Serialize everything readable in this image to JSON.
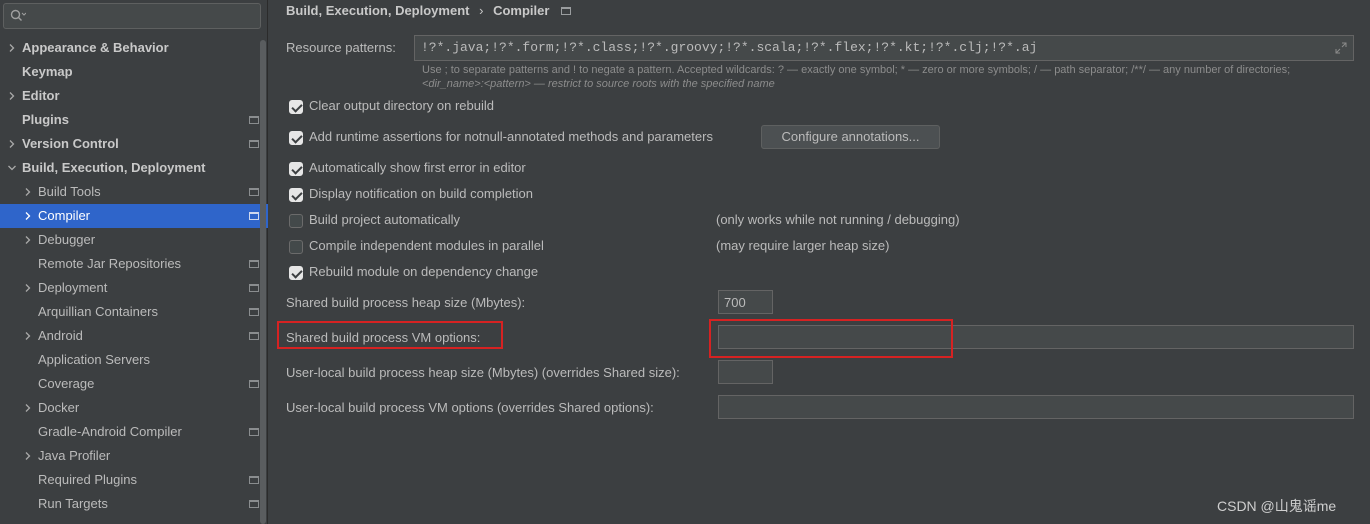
{
  "sidebar": {
    "search": {
      "placeholder": ""
    },
    "items": [
      {
        "label": "Appearance & Behavior",
        "expanded": false,
        "has_chevron": true,
        "level": 0,
        "bold": true,
        "project_icon": false
      },
      {
        "label": "Keymap",
        "has_chevron": false,
        "level": 0,
        "bold": true,
        "project_icon": false
      },
      {
        "label": "Editor",
        "expanded": false,
        "has_chevron": true,
        "level": 0,
        "bold": true,
        "project_icon": false
      },
      {
        "label": "Plugins",
        "has_chevron": false,
        "level": 0,
        "bold": true,
        "project_icon": true
      },
      {
        "label": "Version Control",
        "expanded": false,
        "has_chevron": true,
        "level": 0,
        "bold": true,
        "project_icon": true
      },
      {
        "label": "Build, Execution, Deployment",
        "expanded": true,
        "has_chevron": true,
        "level": 0,
        "bold": true,
        "project_icon": false
      },
      {
        "label": "Build Tools",
        "expanded": false,
        "has_chevron": true,
        "level": 1,
        "bold": false,
        "project_icon": true
      },
      {
        "label": "Compiler",
        "expanded": false,
        "has_chevron": true,
        "level": 1,
        "bold": false,
        "project_icon": true,
        "selected": true
      },
      {
        "label": "Debugger",
        "expanded": false,
        "has_chevron": true,
        "level": 1,
        "bold": false,
        "project_icon": false
      },
      {
        "label": "Remote Jar Repositories",
        "has_chevron": false,
        "level": 1,
        "bold": false,
        "project_icon": true
      },
      {
        "label": "Deployment",
        "expanded": false,
        "has_chevron": true,
        "level": 1,
        "bold": false,
        "project_icon": true
      },
      {
        "label": "Arquillian Containers",
        "has_chevron": false,
        "level": 1,
        "bold": false,
        "project_icon": true
      },
      {
        "label": "Android",
        "expanded": false,
        "has_chevron": true,
        "level": 1,
        "bold": false,
        "project_icon": true
      },
      {
        "label": "Application Servers",
        "has_chevron": false,
        "level": 1,
        "bold": false,
        "project_icon": false
      },
      {
        "label": "Coverage",
        "has_chevron": false,
        "level": 1,
        "bold": false,
        "project_icon": true
      },
      {
        "label": "Docker",
        "expanded": false,
        "has_chevron": true,
        "level": 1,
        "bold": false,
        "project_icon": false
      },
      {
        "label": "Gradle-Android Compiler",
        "has_chevron": false,
        "level": 1,
        "bold": false,
        "project_icon": true
      },
      {
        "label": "Java Profiler",
        "expanded": false,
        "has_chevron": true,
        "level": 1,
        "bold": false,
        "project_icon": false
      },
      {
        "label": "Required Plugins",
        "has_chevron": false,
        "level": 1,
        "bold": false,
        "project_icon": true
      },
      {
        "label": "Run Targets",
        "has_chevron": false,
        "level": 1,
        "bold": false,
        "project_icon": true
      }
    ]
  },
  "breadcrumb": {
    "parent": "Build, Execution, Deployment",
    "separator": "›",
    "current": "Compiler"
  },
  "resource_patterns": {
    "label": "Resource patterns:",
    "value": "!?*.java;!?*.form;!?*.class;!?*.groovy;!?*.scala;!?*.flex;!?*.kt;!?*.clj;!?*.aj",
    "hint_line1": "Use ; to separate patterns and ! to negate a pattern. Accepted wildcards: ? — exactly one symbol; * — zero or more symbols; / — path separator; /**/ — any number of directories;",
    "hint_line2": "<dir_name>:<pattern> — restrict to source roots with the specified name"
  },
  "options": [
    {
      "label": "Clear output directory on rebuild",
      "checked": true,
      "note": ""
    },
    {
      "label": "Add runtime assertions for notnull-annotated methods and parameters",
      "checked": true,
      "note": ""
    },
    {
      "label": "Automatically show first error in editor",
      "checked": true,
      "note": ""
    },
    {
      "label": "Display notification on build completion",
      "checked": true,
      "note": ""
    },
    {
      "label": "Build project automatically",
      "checked": false,
      "note": "(only works while not running / debugging)"
    },
    {
      "label": "Compile independent modules in parallel",
      "checked": false,
      "note": "(may require larger heap size)"
    },
    {
      "label": "Rebuild module on dependency change",
      "checked": true,
      "note": ""
    }
  ],
  "configure_annotations_label": "Configure annotations...",
  "fields": [
    {
      "label": "Shared build process heap size (Mbytes):",
      "value": ""
    },
    {
      "label": "Shared build process VM options:",
      "value": ""
    },
    {
      "label": "User-local build process heap size (Mbytes) (overrides Shared size):",
      "value": ""
    },
    {
      "label": "User-local build process VM options (overrides Shared options):",
      "value": ""
    }
  ],
  "heap_size_value": "700",
  "colors": {
    "background": "#3c3f41",
    "selection": "#2f65ca",
    "highlight_box": "#d62222"
  },
  "watermark": "CSDN @山鬼谣me"
}
